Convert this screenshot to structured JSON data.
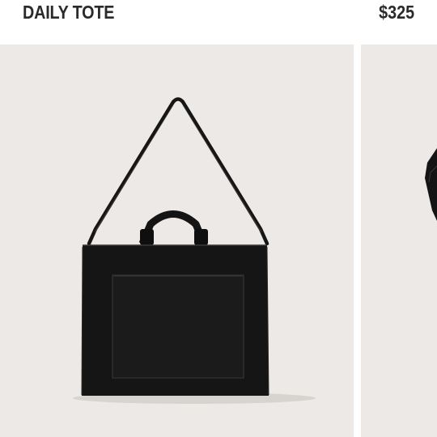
{
  "product": {
    "name": "DAILY TOTE",
    "price": "$325"
  },
  "gallery": {
    "background_color": "#ece9e7",
    "bag_color": "#111111",
    "slides": [
      {
        "icon": "tote-bag-front-image"
      },
      {
        "icon": "tote-bag-angle-image"
      }
    ]
  }
}
